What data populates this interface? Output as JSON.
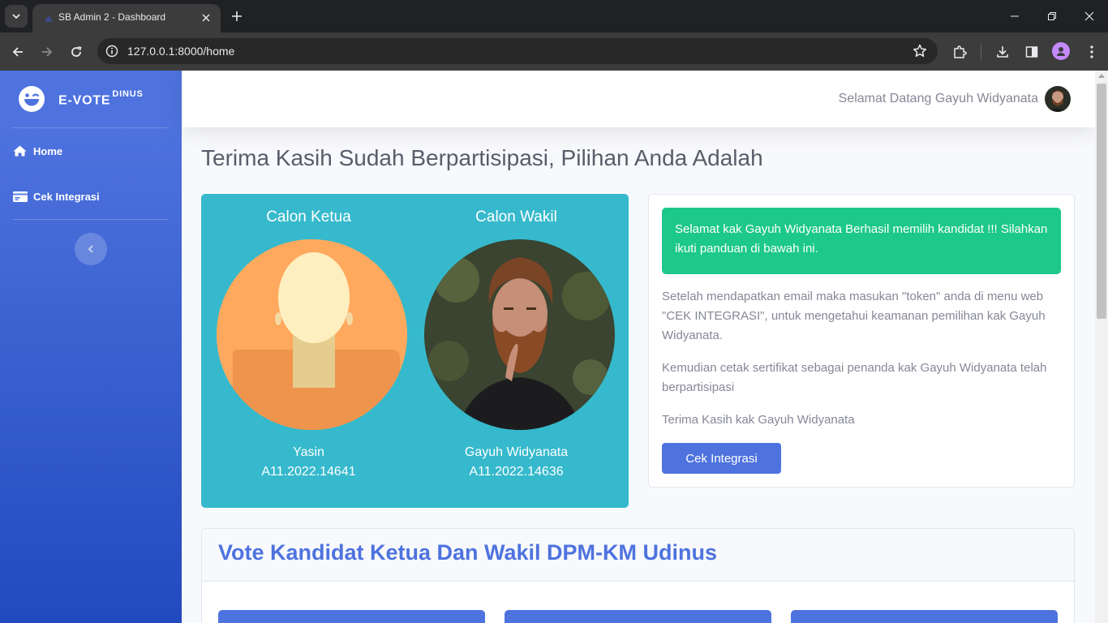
{
  "browser": {
    "tab_title": "SB Admin 2 - Dashboard",
    "url": "127.0.0.1:8000/home"
  },
  "sidebar": {
    "brand_main": "E-VOTE",
    "brand_sup": "DINUS",
    "items": [
      {
        "label": "Home",
        "icon": "home-icon"
      },
      {
        "label": "Cek Integrasi",
        "icon": "id-card-icon"
      }
    ]
  },
  "topbar": {
    "greeting": "Selamat Datang Gayuh Widyanata"
  },
  "main": {
    "heading": "Terima Kasih Sudah Berpartisipasi, Pilihan Anda Adalah",
    "candidates": [
      {
        "role": "Calon Ketua",
        "name": "Yasin",
        "nim": "A11.2022.14641"
      },
      {
        "role": "Calon Wakil",
        "name": "Gayuh Widyanata",
        "nim": "A11.2022.14636"
      }
    ],
    "info": {
      "alert": "Selamat kak Gayuh Widyanata Berhasil memilih kandidat !!! Silahkan ikuti panduan di bawah ini.",
      "p1": "Setelah mendapatkan email maka masukan \"token\" anda di menu web \"CEK INTEGRASI\", untuk mengetahui keamanan pemilihan kak Gayuh Widyanata.",
      "p2": "Kemudian cetak sertifikat sebagai penanda kak Gayuh Widyanata telah berpartisipasi",
      "p3": "Terima Kasih kak Gayuh Widyanata",
      "button": "Cek Integrasi"
    },
    "vote_section_title": "Vote Kandidat Ketua Dan Wakil DPM-KM Udinus"
  },
  "colors": {
    "primary": "#4e73df",
    "info": "#36b9cc",
    "success": "#1cc88a",
    "text_muted": "#858796",
    "heading": "#5a5c69"
  }
}
